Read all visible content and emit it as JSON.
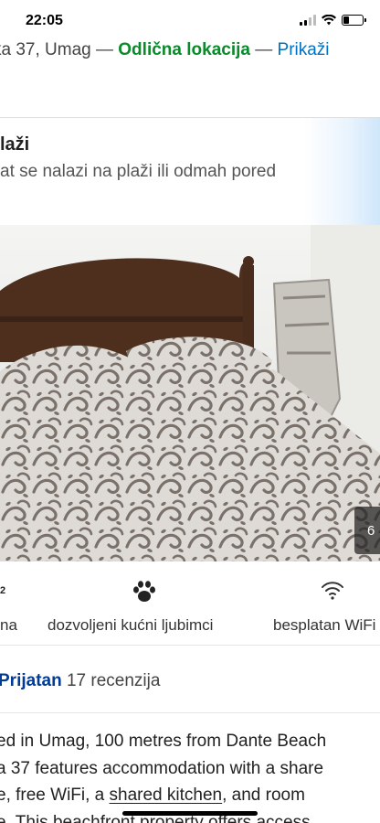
{
  "status_bar": {
    "time": "22:05",
    "battery_level": 0.3
  },
  "address": {
    "text": "ka 37, Umag — ",
    "rating_label": "Odlična lokacija",
    "separator": " — ",
    "link": "Prikaži"
  },
  "beach": {
    "title": "laži",
    "subtitle": "at se nalazi na plaži ili odmah pored"
  },
  "photo": {
    "counter": "6"
  },
  "amenities": [
    {
      "icon": "area-icon",
      "superscript": "2",
      "label": "na"
    },
    {
      "icon": "paw-icon",
      "label": "dozvoljeni kućni ljubimci"
    },
    {
      "icon": "wifi-icon",
      "label": "besplatan WiFi"
    }
  ],
  "reviews": {
    "score_label": "Prijatan",
    "count": "17 recenzija"
  },
  "description": {
    "line1": "ed in Umag, 100 metres from Dante Beach",
    "line2": "a 37 features accommodation with a share",
    "line3_pre": "e, free WiFi, a ",
    "line3_link": "shared kitchen",
    "line3_post": ", and room",
    "line4": "e. This beachfront property offers access"
  }
}
